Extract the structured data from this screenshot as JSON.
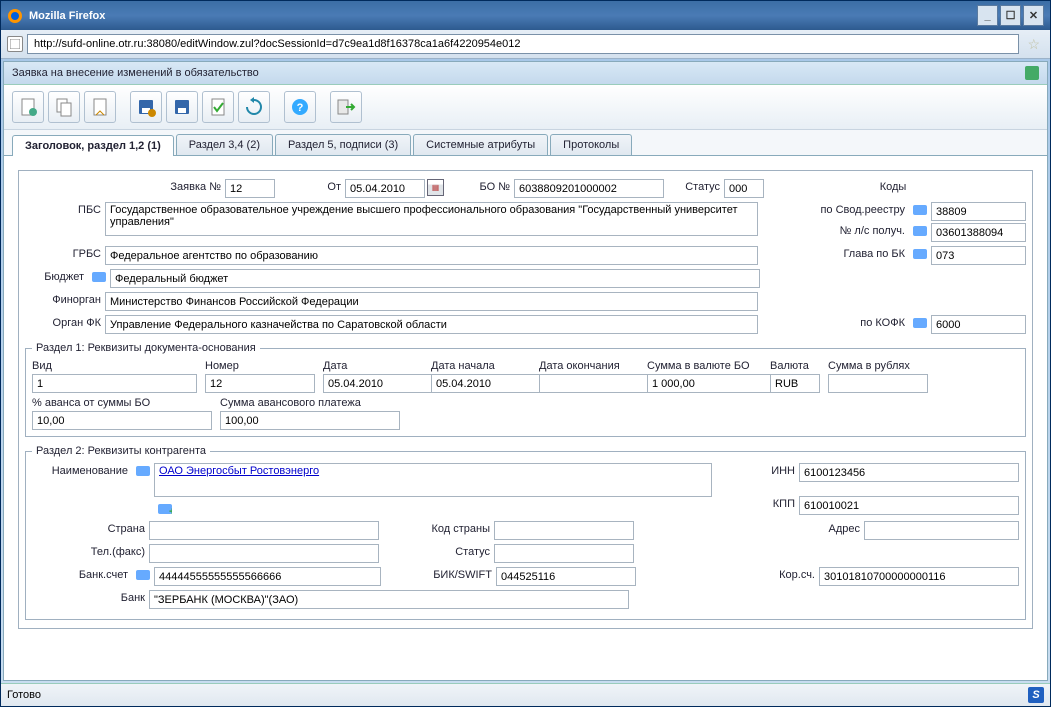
{
  "window": {
    "title": "Mozilla Firefox"
  },
  "address": "http://sufd-online.otr.ru:38080/editWindow.zul?docSessionId=d7c9ea1d8f16378ca1a6f4220954e012",
  "doc_title": "Заявка на внесение изменений в обязательство",
  "tabs": [
    {
      "label": "Заголовок, раздел 1,2 (1)"
    },
    {
      "label": "Раздел 3,4 (2)"
    },
    {
      "label": "Раздел 5, подписи (3)"
    },
    {
      "label": "Системные атрибуты"
    },
    {
      "label": "Протоколы"
    }
  ],
  "hdr": {
    "zayavka_lbl": "Заявка №",
    "zayavka": "12",
    "ot_lbl": "От",
    "ot": "05.04.2010",
    "bo_no_lbl": "БО №",
    "bo_no": "6038809201000002",
    "status_lbl": "Статус",
    "status": "000",
    "kody_lbl": "Коды",
    "pbs_lbl": "ПБС",
    "pbs": "Государственное образовательное учреждение высшего профессионального образования \"Государственный университет управления\"",
    "svod_lbl": "по Свод.реестру",
    "svod": "38809",
    "ls_lbl": "№ л/с получ.",
    "ls": "03601388094",
    "grbs_lbl": "ГРБС",
    "grbs": "Федеральное агентство по образованию",
    "glava_lbl": "Глава по БК",
    "glava": "073",
    "budget_lbl": "Бюджет",
    "budget": "Федеральный бюджет",
    "finorg_lbl": "Финорган",
    "finorg": "Министерство Финансов Российской Федерации",
    "organfk_lbl": "Орган ФК",
    "organfk": "Управление Федерального казначейства по Саратовской области",
    "kofk_lbl": "по КОФК",
    "kofk": "6000"
  },
  "sec1": {
    "legend": "Раздел 1: Реквизиты документа-основания",
    "vid_lbl": "Вид",
    "vid": "1",
    "nomer_lbl": "Номер",
    "nomer": "12",
    "data_lbl": "Дата",
    "data": "05.04.2010",
    "data_nach_lbl": "Дата начала",
    "data_nach": "05.04.2010",
    "data_okon_lbl": "Дата окончания",
    "data_okon": "",
    "summa_bo_lbl": "Сумма в валюте БО",
    "summa_bo": "1 000,00",
    "valuta_lbl": "Валюта",
    "valuta": "RUB",
    "summa_rub_lbl": "Сумма в рублях",
    "summa_rub": "",
    "avans_pct_lbl": "% аванса от суммы БО",
    "avans_pct": "10,00",
    "avans_sum_lbl": "Сумма авансового платежа",
    "avans_sum": "100,00"
  },
  "sec2": {
    "legend": "Раздел 2: Реквизиты контрагента",
    "naim_lbl": "Наименование",
    "naim": "ОАО Энергосбыт Ростовэнерго",
    "inn_lbl": "ИНН",
    "inn": "6100123456",
    "kpp_lbl": "КПП",
    "kpp": "610010021",
    "strana_lbl": "Страна",
    "strana": "",
    "kod_strany_lbl": "Код страны",
    "kod_strany": "",
    "adres_lbl": "Адрес",
    "adres": "",
    "tel_lbl": "Тел.(факс)",
    "tel": "",
    "status2_lbl": "Статус",
    "status2": "",
    "bank_schet_lbl": "Банк.счет",
    "bank_schet": "44444555555555566666",
    "bik_lbl": "БИК/SWIFT",
    "bik": "044525116",
    "korsch_lbl": "Кор.сч.",
    "korsch": "30101810700000000116",
    "bank_lbl": "Банк",
    "bank": "\"ЗЕРБАНК (МОСКВА)\"(ЗАО)"
  },
  "status_text": "Готово"
}
